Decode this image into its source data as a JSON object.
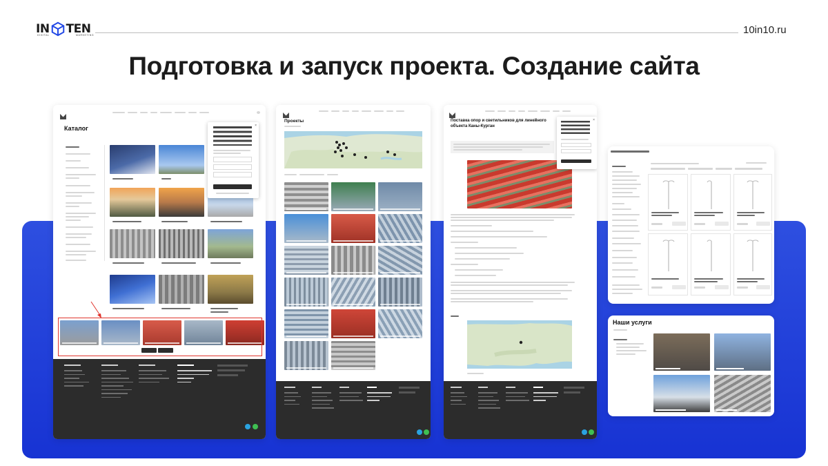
{
  "header": {
    "logo_left": "IN",
    "logo_right": "TEN",
    "logo_sub_left": "DIGITAL",
    "logo_sub_right": "MARKETING",
    "site_url": "10in10.ru"
  },
  "title": "Подготовка и запуск проекта. Создание сайта",
  "screens": {
    "catalog": {
      "heading": "Каталог"
    },
    "projects": {
      "heading": "Проекты"
    },
    "project_detail": {
      "heading": "Поставка опор и светильников для линейного объекта Каны-Курган"
    },
    "services": {
      "heading": "Наши услуги"
    }
  },
  "colors": {
    "accent_yellow": "#f6cb1b",
    "band_blue": "#1f3fd9",
    "highlight_red": "#e0342c",
    "footer_dark": "#2c2c2c"
  }
}
